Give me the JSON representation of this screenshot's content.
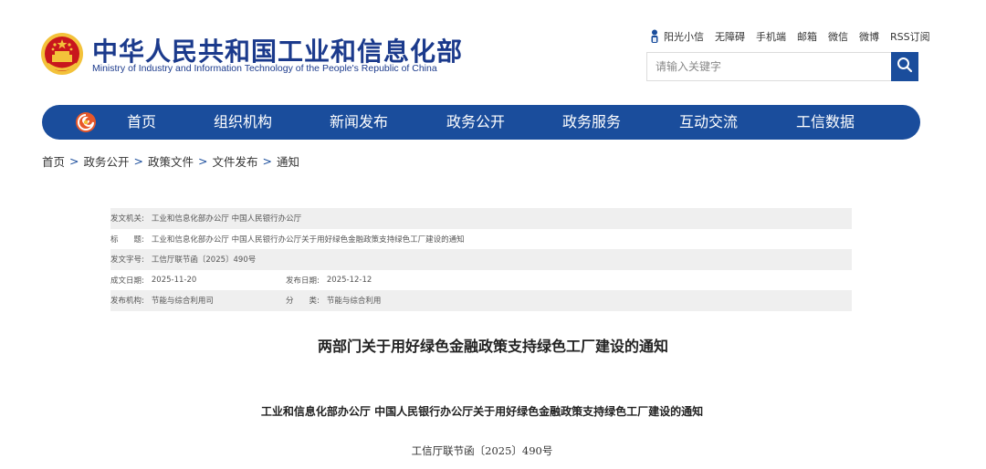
{
  "header": {
    "title": "中华人民共和国工业和信息化部",
    "subtitle": "Ministry of Industry and Information Technology of the People's Republic of China",
    "emblem_icon": "national-emblem-icon"
  },
  "toplinks": {
    "icon": "person-icon",
    "items": [
      "阳光小信",
      "无障碍",
      "手机端",
      "邮箱",
      "微信",
      "微博",
      "RSS订阅"
    ]
  },
  "search": {
    "placeholder": "请输入关键字",
    "icon": "search-icon"
  },
  "nav": {
    "logo_icon": "swirl-logo-icon",
    "items": [
      "首页",
      "组织机构",
      "新闻发布",
      "政务公开",
      "政务服务",
      "互动交流",
      "工信数据"
    ]
  },
  "breadcrumb": {
    "items": [
      "首页",
      "政务公开",
      "政策文件",
      "文件发布",
      "通知"
    ],
    "separator": ">"
  },
  "meta": {
    "issuer_label": "发文机关:",
    "issuer_value": "工业和信息化部办公厅 中国人民银行办公厅",
    "title_label": "标　　题:",
    "title_value": "工业和信息化部办公厅 中国人民银行办公厅关于用好绿色金融政策支持绿色工厂建设的通知",
    "docno_label": "发文字号:",
    "docno_value": "工信厅联节函〔2025〕490号",
    "created_label": "成文日期:",
    "created_value": "2025-11-20",
    "published_label": "发布日期:",
    "published_value": "2025-12-12",
    "org_label": "发布机构:",
    "org_value": "节能与综合利用司",
    "category_label": "分　　类:",
    "category_value": "节能与综合利用"
  },
  "document": {
    "title": "两部门关于用好绿色金融政策支持绿色工厂建设的通知",
    "issuer_line": "工业和信息化部办公厅  中国人民银行办公厅关于用好绿色金融政策支持绿色工厂建设的通知",
    "number_line": "工信厅联节函〔2025〕490号"
  },
  "colors": {
    "brand_blue": "#1a4d9c",
    "title_blue": "#1b3a8c",
    "row_shade": "#efefef",
    "emblem_red": "#c8161d",
    "emblem_gold": "#f3c23a"
  }
}
